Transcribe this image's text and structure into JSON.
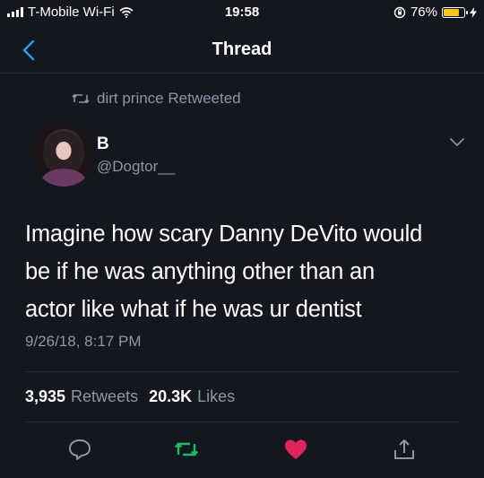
{
  "status_bar": {
    "carrier": "T-Mobile Wi-Fi",
    "time": "19:58",
    "battery_percent": "76%",
    "battery_level": 0.76,
    "battery_color": "#f5c518"
  },
  "nav": {
    "title": "Thread",
    "back_icon": "chevron-left-icon"
  },
  "retweet": {
    "text": "dirt prince Retweeted"
  },
  "tweet": {
    "name": "B",
    "handle": "@Dogtor__",
    "lines": [
      "Imagine how scary Danny DeVito would",
      "be if he was anything other than an",
      "actor like what if he was ur dentist"
    ],
    "timestamp": "9/26/18, 8:17 PM"
  },
  "stats": {
    "retweets_count": "3,935",
    "retweets_label": "Retweets",
    "likes_count": "20.3K",
    "likes_label": "Likes"
  },
  "colors": {
    "accent_blue": "#1da1f2",
    "retweet_green": "#17bf63",
    "like_red": "#e0245e",
    "muted": "#8899a6"
  }
}
